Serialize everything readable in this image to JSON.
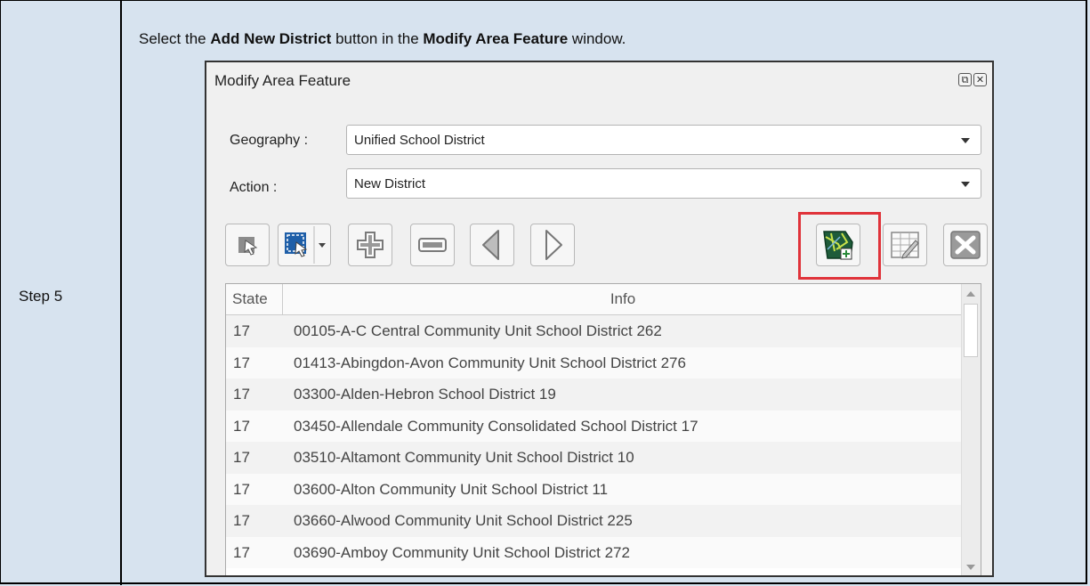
{
  "step": {
    "label": "Step 5"
  },
  "instruction": {
    "prefix": "Select the ",
    "button_name": "Add New District",
    "middle": " button in the ",
    "window_name": "Modify Area Feature",
    "suffix": " window."
  },
  "dialog": {
    "title": "Modify Area Feature",
    "title_buttons": {
      "float": "⧉",
      "close": "✕"
    },
    "geography": {
      "label": "Geography :",
      "value": "Unified School District"
    },
    "action": {
      "label": "Action :",
      "value": "New District"
    },
    "toolbar": [
      {
        "name": "select-feature-tool",
        "icon": "select-cursor-icon"
      },
      {
        "name": "select-region-tool",
        "icon": "region-select-icon"
      },
      {
        "name": "add-tool",
        "icon": "plus-icon"
      },
      {
        "name": "remove-tool",
        "icon": "minus-icon"
      },
      {
        "name": "previous-tool",
        "icon": "left-arrow-icon"
      },
      {
        "name": "next-tool",
        "icon": "right-arrow-icon"
      },
      {
        "name": "add-new-district-button",
        "icon": "map-add-icon"
      },
      {
        "name": "edit-table-button",
        "icon": "table-edit-icon"
      },
      {
        "name": "delete-button",
        "icon": "x-icon"
      }
    ],
    "table": {
      "headers": [
        "State",
        "Info"
      ],
      "rows": [
        [
          "17",
          "00105-A-C Central Community Unit School District 262"
        ],
        [
          "17",
          "01413-Abingdon-Avon Community Unit School District 276"
        ],
        [
          "17",
          "03300-Alden-Hebron School District 19"
        ],
        [
          "17",
          "03450-Allendale Community Consolidated School District 17"
        ],
        [
          "17",
          "03510-Altamont Community Unit School District 10"
        ],
        [
          "17",
          "03600-Alton Community Unit School District 11"
        ],
        [
          "17",
          "03660-Alwood Community Unit School District 225"
        ],
        [
          "17",
          "03690-Amboy Community Unit School District 272"
        ]
      ]
    },
    "highlight_color": "#e0333a"
  }
}
